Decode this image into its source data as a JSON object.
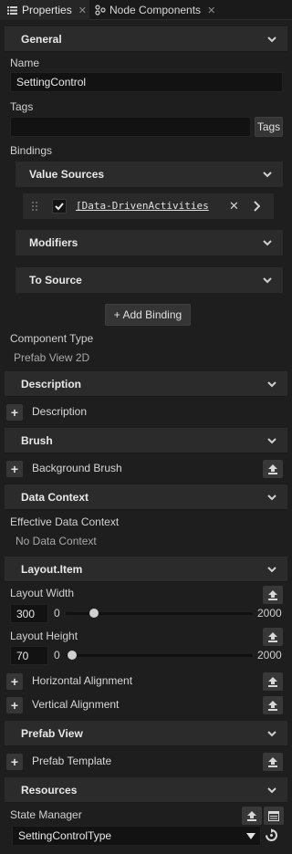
{
  "tabs": [
    {
      "label": "Properties",
      "active": true
    },
    {
      "label": "Node Components",
      "active": false
    }
  ],
  "sections": {
    "general": "General",
    "description": "Description",
    "brush": "Brush",
    "data_context": "Data Context",
    "layout_item": "Layout.Item",
    "prefab_view": "Prefab View",
    "resources": "Resources"
  },
  "name": {
    "label": "Name",
    "value": "SettingControl"
  },
  "tags": {
    "label": "Tags",
    "button": "Tags",
    "value": ""
  },
  "bindings": {
    "label": "Bindings",
    "value_sources": "Value Sources",
    "source_item": "[Data-DrivenActivities",
    "source_checked": true,
    "modifiers": "Modifiers",
    "to_source": "To Source",
    "add_binding": "+ Add Binding"
  },
  "component_type": {
    "label": "Component Type",
    "value": "Prefab View 2D"
  },
  "description_row": "Description",
  "brush_row": "Background Brush",
  "effective_data_context": {
    "label": "Effective Data Context",
    "value": "No Data Context"
  },
  "layout": {
    "width": {
      "label": "Layout Width",
      "value": "300",
      "min": "0",
      "max": "2000",
      "fraction": 0.15
    },
    "height": {
      "label": "Layout Height",
      "value": "70",
      "min": "0",
      "max": "2000",
      "fraction": 0.035
    },
    "horizontal_alignment": "Horizontal Alignment",
    "vertical_alignment": "Vertical Alignment"
  },
  "prefab_template": "Prefab Template",
  "state_manager": {
    "label": "State Manager",
    "value": "SettingControlType"
  },
  "colors": {
    "background": "#1e1e1e",
    "section": "#2b2b2b",
    "field": "#121212",
    "accent_text": "#e8e8e8"
  }
}
